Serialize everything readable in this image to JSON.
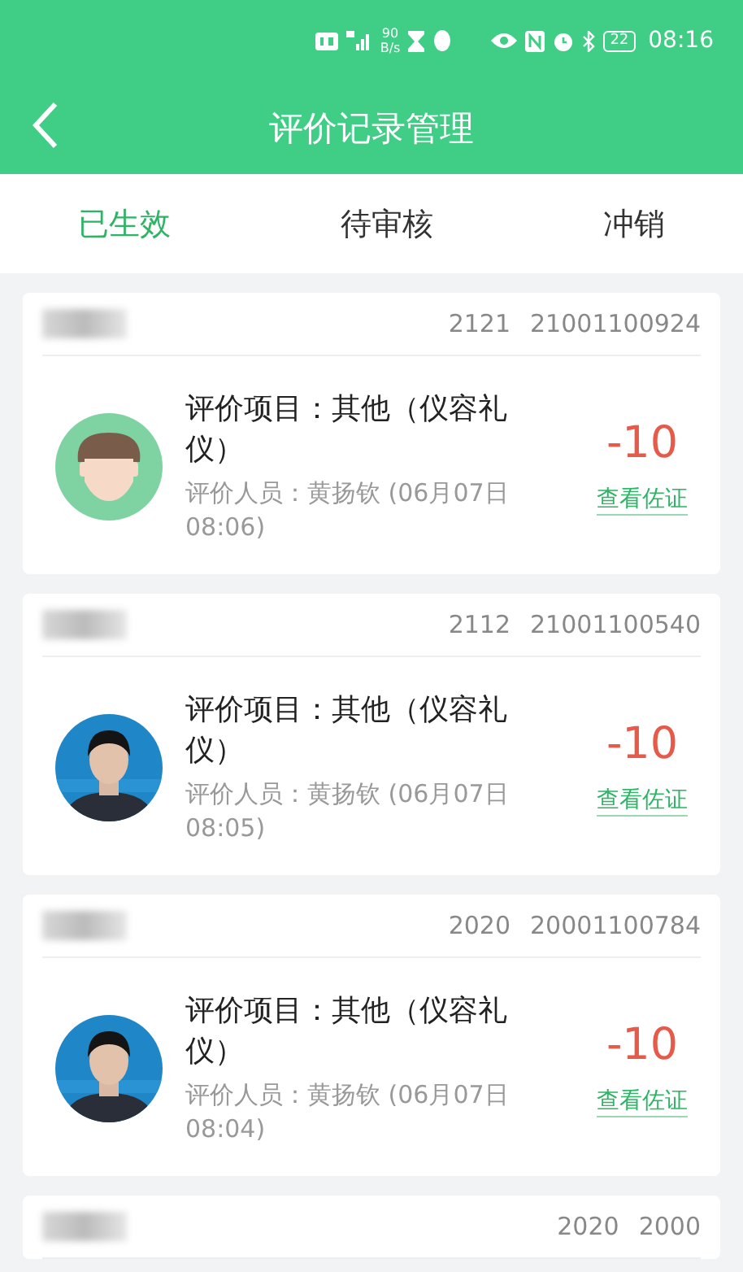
{
  "status_bar": {
    "speed": "90",
    "speed_unit": "B/s",
    "battery": "22",
    "time": "08:16"
  },
  "header": {
    "title": "评价记录管理"
  },
  "tabs": [
    {
      "label": "已生效",
      "selected": true
    },
    {
      "label": "待审核",
      "selected": false
    },
    {
      "label": "冲销",
      "selected": false
    }
  ],
  "records": [
    {
      "class": "2121",
      "student_id": "21001100924",
      "avatar": {
        "kind": "default"
      },
      "item": "评价项目：其他（仪容礼仪）",
      "evaluator": "评价人员：黄扬钦 (06月07日 08:06)",
      "score": "-10",
      "link": "查看佐证"
    },
    {
      "class": "2112",
      "student_id": "21001100540",
      "item": "评价项目：其他（仪容礼仪）",
      "evaluator": "评价人员：黄扬钦 (06月07日 08:05)",
      "score": "-10",
      "link": "查看佐证"
    },
    {
      "class": "2020",
      "student_id": "20001100784",
      "item": "评价项目：其他（仪容礼仪）",
      "evaluator": "评价人员：黄扬钦 (06月07日 08:04)",
      "score": "-10",
      "link": "查看佐证"
    },
    {
      "class": "2020",
      "student_id": "2000"
    }
  ]
}
